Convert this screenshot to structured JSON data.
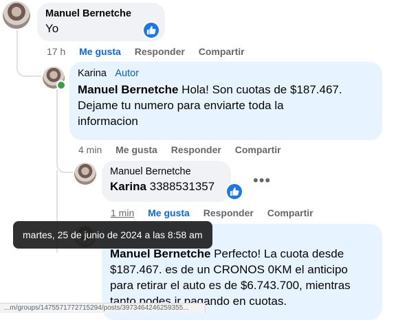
{
  "comments": [
    {
      "author": "Manuel Bernetche",
      "text": "Yo",
      "time": "17 h",
      "actions": [
        "Me gusta",
        "Responder",
        "Compartir"
      ]
    },
    {
      "author": "Karina",
      "badge": "Autor",
      "mention": "Manuel Bernetche",
      "text_lines": [
        " Hola! Son cuotas de $187.467.",
        "Dejame tu numero para enviarte toda la",
        "informacion"
      ],
      "time": "4 min",
      "actions": [
        "Me gusta",
        "Responder",
        "Compartir"
      ]
    },
    {
      "author": "Manuel Bernetche",
      "mention": "Karina",
      "text": " 3388531357",
      "time": "1 min",
      "actions": [
        "Me gusta",
        "Responder",
        "Compartir"
      ]
    },
    {
      "mention": "Manuel Bernetche",
      "text_lines": [
        " Perfecto! La cuota desde",
        "$187.467. es de un CRONOS 0KM el anticipo",
        "para retirar el auto es de $6.743.700, mientras",
        "tanto podes ir pagando en cuotas."
      ]
    }
  ],
  "tooltip": "martes, 25 de junio de 2024 a las 8:58 am",
  "status_url": "...m/groups/1475571772715294/posts/3973464246259355...",
  "colors": {
    "link_blue": "#0866ff",
    "like_blue": "#1877f2",
    "bubble_gray": "#f0f2f5",
    "bubble_blue": "#e7f3ff"
  },
  "icons": [
    "like-icon",
    "more-options-icon",
    "online-status-icon"
  ]
}
